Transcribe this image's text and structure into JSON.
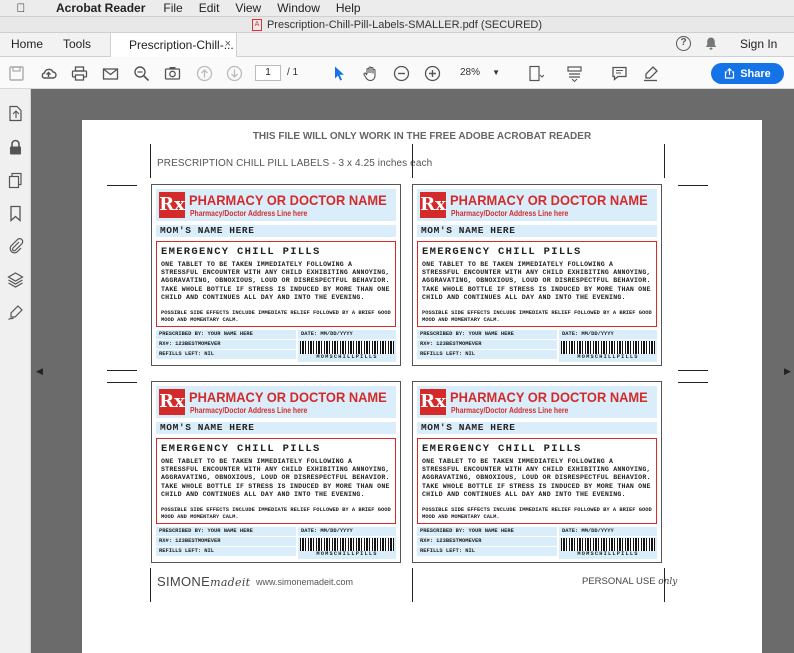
{
  "menubar": {
    "app_name": "Acrobat Reader",
    "items": [
      "File",
      "Edit",
      "View",
      "Window",
      "Help"
    ]
  },
  "window": {
    "title": "Prescription-Chill-Pill-Labels-SMALLER.pdf (SECURED)"
  },
  "tabs": {
    "home": "Home",
    "tools": "Tools",
    "document": "Prescription-Chill-...",
    "close": "×",
    "sign_in": "Sign In"
  },
  "toolbar": {
    "page_current": "1",
    "page_total": "/ 1",
    "zoom": "28%",
    "share_label": "Share"
  },
  "colors": {
    "accent": "#1473e6",
    "rx_red": "#d52a2a",
    "label_blue": "#d9eefa",
    "viewer_bg": "#6b6b6b"
  },
  "document": {
    "warning": "THIS FILE WILL ONLY WORK IN THE FREE ADOBE ACROBAT READER",
    "sheet_title": "PRESCRIPTION CHILL PILL LABELS - 3 x 4.25 inches each",
    "label": {
      "rx": "Rx",
      "pharmacy": "PHARMACY OR DOCTOR NAME",
      "address": "Pharmacy/Doctor Address Line here",
      "patient": "MOM'S NAME HERE",
      "drug": "EMERGENCY CHILL PILLS",
      "instructions": "ONE TABLET TO BE TAKEN IMMEDIATELY FOLLOWING A STRESSFUL ENCOUNTER WITH ANY CHILD EXHIBITING ANNOYING, AGGRAVATING, OBNOXIOUS, LOUD OR DISRESPECTFUL BEHAVIOR. TAKE WHOLE BOTTLE IF STRESS IS INDUCED BY MORE THAN ONE CHILD AND CONTINUES ALL DAY AND INTO THE EVENING.",
      "side_effects": "POSSIBLE SIDE EFFECTS INCLUDE IMMEDIATE RELIEF FOLLOWED BY A BRIEF GOOD MOOD AND MOMENTARY CALM.",
      "prescribed_by": "PRESCRIBED BY: YOUR NAME HERE",
      "date": "DATE: MM/DD/YYYY",
      "rx_number": "RX#: 123BESTMOMEVER",
      "refills": "REFILLS LEFT: NIL",
      "barcode_text": "MOMSCHILLPILLS"
    },
    "footer": {
      "brand_a": "SIMONE",
      "brand_b": "madeit",
      "url": "www.simonemadeit.com",
      "personal_a": "PERSONAL USE ",
      "personal_b": "only"
    }
  }
}
